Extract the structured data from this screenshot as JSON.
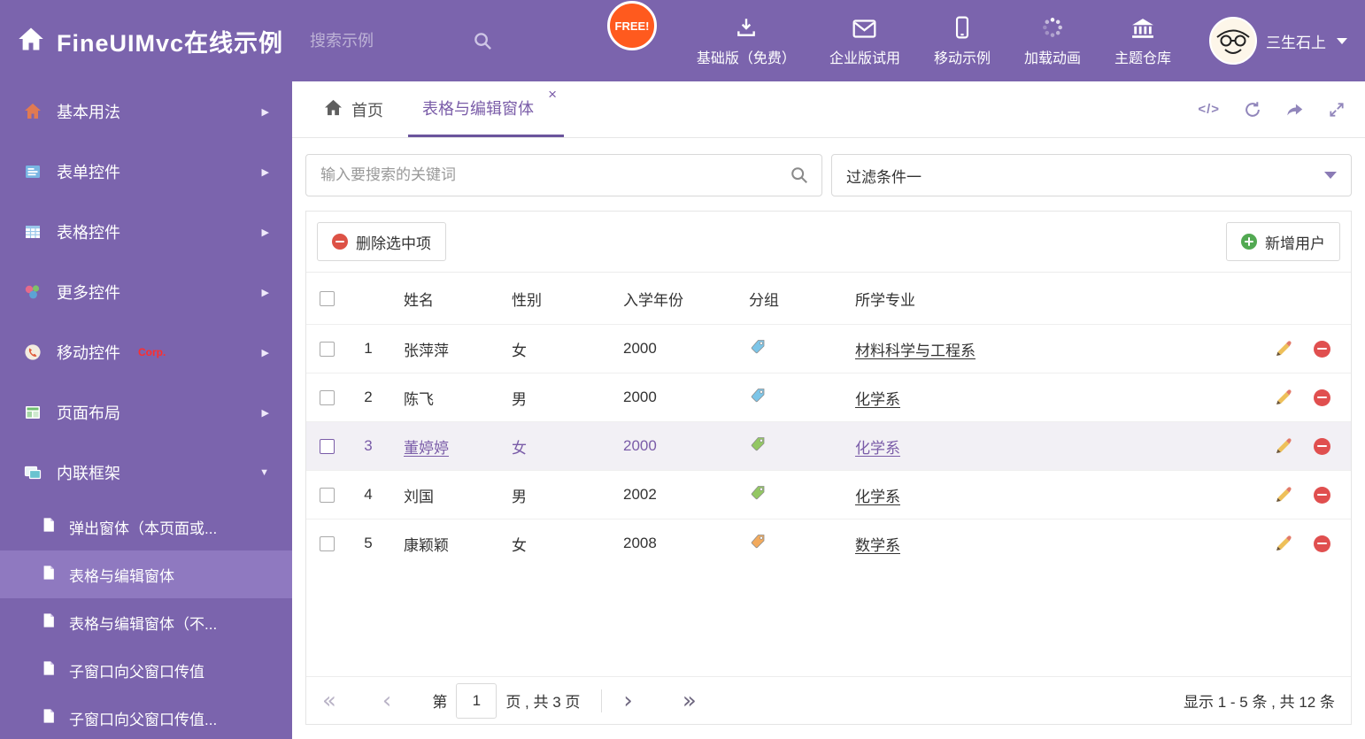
{
  "header": {
    "app_title": "FineUIMvc在线示例",
    "search_placeholder": "搜索示例",
    "free_badge": "FREE!",
    "nav_items": [
      {
        "label": "基础版（免费）",
        "icon": "download-icon"
      },
      {
        "label": "企业版试用",
        "icon": "envelope-icon"
      },
      {
        "label": "移动示例",
        "icon": "mobile-icon"
      },
      {
        "label": "加载动画",
        "icon": "loader-icon"
      },
      {
        "label": "主题仓库",
        "icon": "bank-icon"
      }
    ],
    "user_name": "三生石上"
  },
  "sidebar": {
    "items": [
      {
        "label": "基本用法",
        "icon": "home-icon"
      },
      {
        "label": "表单控件",
        "icon": "form-icon"
      },
      {
        "label": "表格控件",
        "icon": "table-icon"
      },
      {
        "label": "更多控件",
        "icon": "widgets-icon"
      },
      {
        "label": "移动控件",
        "icon": "mobile-icon",
        "badge": "Corp."
      },
      {
        "label": "页面布局",
        "icon": "layout-icon"
      },
      {
        "label": "内联框架",
        "icon": "frame-icon",
        "expanded": true
      }
    ],
    "subitems": [
      {
        "label": "弹出窗体（本页面或..."
      },
      {
        "label": "表格与编辑窗体",
        "active": true
      },
      {
        "label": "表格与编辑窗体（不..."
      },
      {
        "label": "子窗口向父窗口传值"
      },
      {
        "label": "子窗口向父窗口传值..."
      }
    ]
  },
  "tabs": {
    "home": "首页",
    "active_tab": "表格与编辑窗体"
  },
  "filters": {
    "search_placeholder": "输入要搜索的关键词",
    "filter_value": "过滤条件一"
  },
  "toolbar": {
    "delete_label": "删除选中项",
    "add_label": "新增用户"
  },
  "table": {
    "columns": [
      "姓名",
      "性别",
      "入学年份",
      "分组",
      "所学专业"
    ],
    "rows": [
      {
        "no": "1",
        "name": "张萍萍",
        "gender": "女",
        "year": "2000",
        "tag_color": "#7cc5e8",
        "major": "材料科学与工程系"
      },
      {
        "no": "2",
        "name": "陈飞",
        "gender": "男",
        "year": "2000",
        "tag_color": "#7cc5e8",
        "major": "化学系"
      },
      {
        "no": "3",
        "name": "董婷婷",
        "gender": "女",
        "year": "2000",
        "tag_color": "#93c763",
        "major": "化学系",
        "selected": true
      },
      {
        "no": "4",
        "name": "刘国",
        "gender": "男",
        "year": "2002",
        "tag_color": "#93c763",
        "major": "化学系"
      },
      {
        "no": "5",
        "name": "康颖颖",
        "gender": "女",
        "year": "2008",
        "tag_color": "#f2aa5d",
        "major": "数学系"
      }
    ]
  },
  "pagination": {
    "prefix": "第",
    "current_page": "1",
    "suffix": "页 , 共 3 页",
    "summary": "显示 1 - 5 条 , 共 12 条"
  },
  "icons": {
    "close": "×",
    "chevron_right": "▶",
    "chevron_down": "▼",
    "code": "</>",
    "first": "«",
    "prev": "‹",
    "next": "›",
    "last": "»"
  },
  "colors": {
    "primary": "#7b64ad",
    "accent": "#6a549c",
    "sidebar_active": "#8f79c0",
    "free_badge": "#ff5a1e",
    "danger": "#dd5246",
    "success": "#52a952",
    "selected_row_bg": "#f2f0f5",
    "selected_row_text": "#7a5ca8"
  }
}
